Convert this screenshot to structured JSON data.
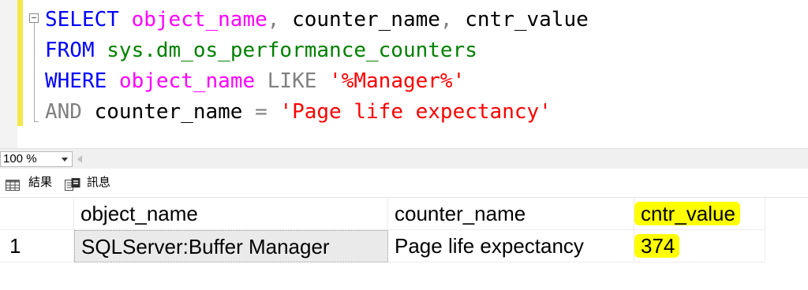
{
  "editor": {
    "lines": [
      [
        {
          "t": "SELECT",
          "c": "kw"
        },
        {
          "t": " ",
          "c": "plain"
        },
        {
          "t": "object_name",
          "c": "pink"
        },
        {
          "t": ", ",
          "c": "gray"
        },
        {
          "t": "counter_name",
          "c": "plain"
        },
        {
          "t": ", ",
          "c": "gray"
        },
        {
          "t": "cntr_value",
          "c": "plain"
        }
      ],
      [
        {
          "t": "FROM",
          "c": "kw"
        },
        {
          "t": " ",
          "c": "plain"
        },
        {
          "t": "sys.dm_os_performance_counters",
          "c": "obj"
        }
      ],
      [
        {
          "t": "WHERE",
          "c": "kw"
        },
        {
          "t": " ",
          "c": "plain"
        },
        {
          "t": "object_name",
          "c": "pink"
        },
        {
          "t": " LIKE ",
          "c": "gray"
        },
        {
          "t": "'%Manager%'",
          "c": "str"
        }
      ],
      [
        {
          "t": "AND",
          "c": "gray"
        },
        {
          "t": " counter_name ",
          "c": "plain"
        },
        {
          "t": "=",
          "c": "gray"
        },
        {
          "t": " ",
          "c": "plain"
        },
        {
          "t": "'Page life expectancy'",
          "c": "str"
        }
      ]
    ]
  },
  "zoom": {
    "value": "100 %"
  },
  "tabs": {
    "results": "結果",
    "messages": "訊息"
  },
  "grid": {
    "columns": [
      "object_name",
      "counter_name",
      "cntr_value"
    ],
    "rows": [
      {
        "num": "1",
        "cells": [
          "SQLServer:Buffer Manager",
          "Page life expectancy",
          "374"
        ]
      }
    ]
  },
  "colors": {
    "keyword": "#0000ff",
    "function_pink": "#ff00ff",
    "system_object": "#008000",
    "string": "#ff0000",
    "operator_gray": "#808080",
    "highlight": "#ffff00"
  }
}
